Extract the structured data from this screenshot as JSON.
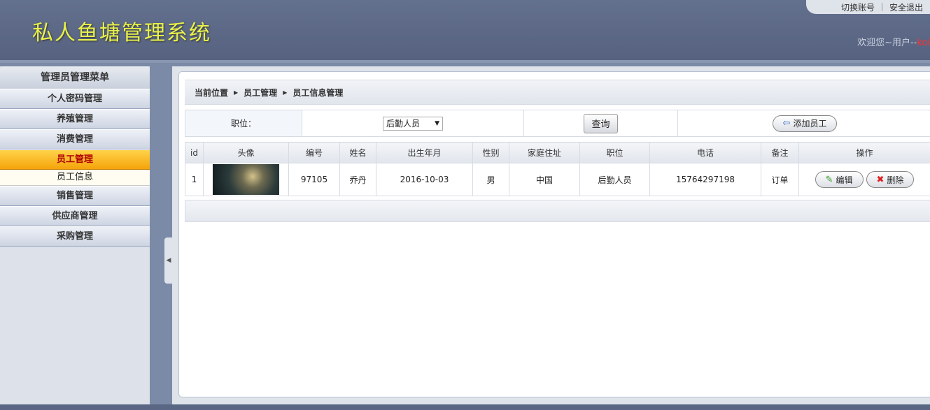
{
  "header": {
    "logo": "私人鱼塘管理系统",
    "switch_account": "切换账号",
    "logout": "安全退出",
    "welcome_prefix": "欢迎您~用户--",
    "username": "kol"
  },
  "sidebar": {
    "title": "管理员管理菜单",
    "items": [
      {
        "label": "个人密码管理"
      },
      {
        "label": "养殖管理"
      },
      {
        "label": "消费管理"
      },
      {
        "label": "员工管理"
      },
      {
        "label": "员工信息"
      },
      {
        "label": "销售管理"
      },
      {
        "label": "供应商管理"
      },
      {
        "label": "采购管理"
      }
    ]
  },
  "breadcrumb": [
    "当前位置",
    "员工管理",
    "员工信息管理"
  ],
  "search": {
    "position_label": "职位：",
    "position_value": "后勤人员",
    "query_button": "查询",
    "add_button": "添加员工"
  },
  "table": {
    "headers": [
      "id",
      "头像",
      "编号",
      "姓名",
      "出生年月",
      "性别",
      "家庭住址",
      "职位",
      "电话",
      "备注",
      "操作"
    ],
    "rows": [
      {
        "id": "1",
        "code": "97105",
        "name": "乔丹",
        "birth": "2016-10-03",
        "gender": "男",
        "address": "中国",
        "position": "后勤人员",
        "phone": "15764297198",
        "note": "订单"
      }
    ],
    "edit_label": "编辑",
    "delete_label": "删除"
  },
  "colors": {
    "active_item": "#f4a40a",
    "logo": "#e9f24a",
    "username": "#ff3030"
  }
}
